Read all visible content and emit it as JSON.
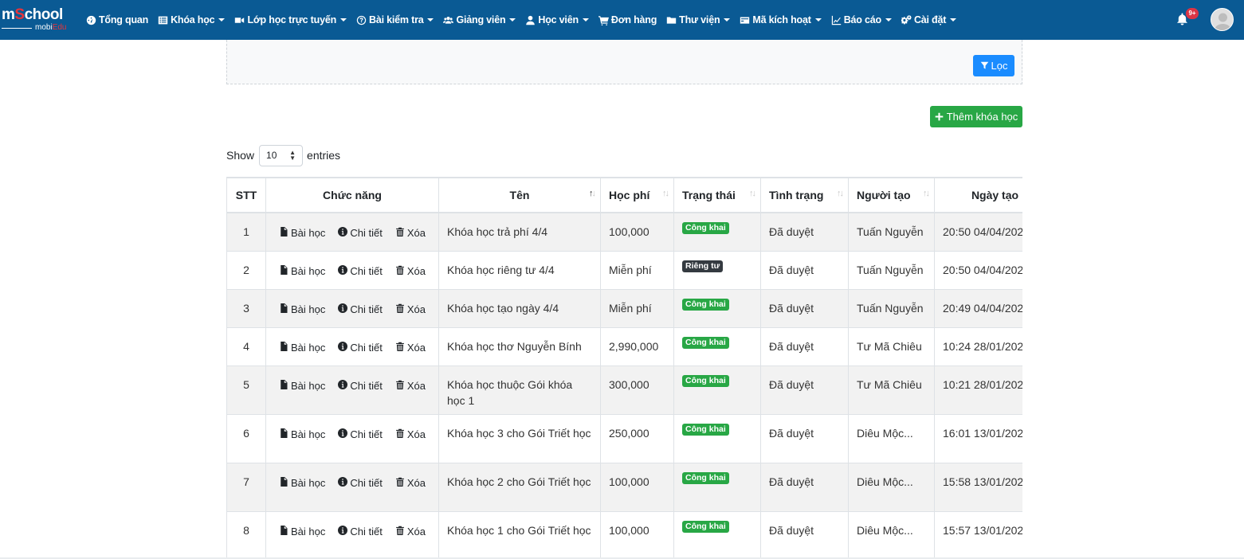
{
  "brand": {
    "main_prefix": "m",
    "main_s": "S",
    "main_suffix": "chool",
    "sub_prefix": "mobi",
    "sub_suffix": "Edu"
  },
  "nav": {
    "items": [
      {
        "label": "Tổng quan",
        "icon": "dashboard-icon",
        "dropdown": false
      },
      {
        "label": "Khóa học",
        "icon": "list-icon",
        "dropdown": true
      },
      {
        "label": "Lớp học trực tuyến",
        "icon": "video-icon",
        "dropdown": true
      },
      {
        "label": "Bài kiểm tra",
        "icon": "question-icon",
        "dropdown": true
      },
      {
        "label": "Giảng viên",
        "icon": "users-icon",
        "dropdown": true
      },
      {
        "label": "Học viên",
        "icon": "user-icon",
        "dropdown": true
      },
      {
        "label": "Đơn hàng",
        "icon": "cart-icon",
        "dropdown": false
      },
      {
        "label": "Thư viện",
        "icon": "folder-icon",
        "dropdown": true
      },
      {
        "label": "Mã kích hoạt",
        "icon": "card-icon",
        "dropdown": true
      },
      {
        "label": "Báo cáo",
        "icon": "chart-icon",
        "dropdown": true
      },
      {
        "label": "Cài đặt",
        "icon": "cogs-icon",
        "dropdown": true
      }
    ],
    "notification_badge": "9+"
  },
  "filter": {
    "button_label": "Lọc"
  },
  "add_course_button": "Thêm khóa học",
  "entries": {
    "show_label": "Show",
    "value": "10",
    "suffix_label": "entries"
  },
  "table": {
    "headers": {
      "stt": "STT",
      "actions": "Chức năng",
      "name": "Tên",
      "fee": "Học phí",
      "status": "Trạng thái",
      "approval": "Tình trạng",
      "creator": "Người tạo",
      "created": "Ngày tạo"
    },
    "action_labels": {
      "lessons": "Bài học",
      "details": "Chi tiết",
      "delete": "Xóa"
    },
    "rows": [
      {
        "stt": "1",
        "name": "Khóa học trả phí 4/4",
        "fee": "100,000",
        "status": "Công khai",
        "status_color": "#28a745",
        "approval": "Đã duyệt",
        "creator": "Tuấn Nguyễn",
        "created": "20:50 04/04/202"
      },
      {
        "stt": "2",
        "name": "Khóa học riêng tư 4/4",
        "fee": "Miễn phí",
        "status": "Riêng tư",
        "status_color": "#343a40",
        "approval": "Đã duyệt",
        "creator": "Tuấn Nguyễn",
        "created": "20:50 04/04/202"
      },
      {
        "stt": "3",
        "name": "Khóa học tạo ngày 4/4",
        "fee": "Miễn phí",
        "status": "Công khai",
        "status_color": "#28a745",
        "approval": "Đã duyệt",
        "creator": "Tuấn Nguyễn",
        "created": "20:49 04/04/202"
      },
      {
        "stt": "4",
        "name": "Khóa học thơ Nguyễn Bính",
        "fee": "2,990,000",
        "status": "Công khai",
        "status_color": "#28a745",
        "approval": "Đã duyệt",
        "creator": "Tư Mã Chiêu",
        "created": "10:24 28/01/202"
      },
      {
        "stt": "5",
        "name": "Khóa học thuộc Gói khóa học 1",
        "fee": "300,000",
        "status": "Công khai",
        "status_color": "#28a745",
        "approval": "Đã duyệt",
        "creator": "Tư Mã Chiêu",
        "created": "10:21 28/01/202"
      },
      {
        "stt": "6",
        "name": "Khóa học 3 cho Gói Triết học",
        "fee": "250,000",
        "status": "Công khai",
        "status_color": "#28a745",
        "approval": "Đã duyệt",
        "creator": "Diêu Mộc...",
        "created": "16:01 13/01/202"
      },
      {
        "stt": "7",
        "name": "Khóa học 2 cho Gói Triết học",
        "fee": "100,000",
        "status": "Công khai",
        "status_color": "#28a745",
        "approval": "Đã duyệt",
        "creator": "Diêu Mộc...",
        "created": "15:58 13/01/202"
      },
      {
        "stt": "8",
        "name": "Khóa học 1 cho Gói Triết học",
        "fee": "100,000",
        "status": "Công khai",
        "status_color": "#28a745",
        "approval": "Đã duyệt",
        "creator": "Diêu Mộc...",
        "created": "15:57 13/01/202"
      }
    ]
  },
  "colors": {
    "navbar": "#0a5a94",
    "primary": "#1a8cff",
    "success": "#28a745",
    "dark": "#343a40",
    "danger": "#dc3545"
  }
}
